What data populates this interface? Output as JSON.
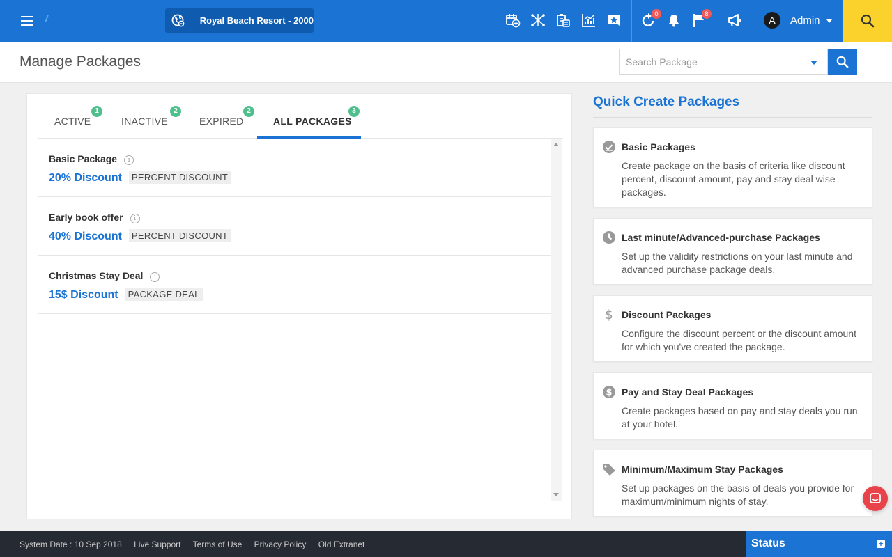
{
  "topbar": {
    "property_label": "Royal Beach Resort -  2000",
    "icons": [
      "calendar-add-icon",
      "network-icon",
      "clipboard-icon",
      "chart-icon",
      "star-icon"
    ],
    "refresh_badge": "0",
    "flag_badge": "8",
    "admin_initial": "A",
    "admin_name": "Admin",
    "colors": {
      "primary": "#1b73d3",
      "search_button": "#fbd22b",
      "badge": "#ef5a5a"
    }
  },
  "header": {
    "title": "Manage Packages",
    "search_placeholder": "Search Package"
  },
  "tabs": [
    {
      "label": "ACTIVE",
      "count": "1"
    },
    {
      "label": "INACTIVE",
      "count": "2"
    },
    {
      "label": "EXPIRED",
      "count": "2"
    },
    {
      "label": "ALL PACKAGES",
      "count": "3",
      "active": true
    }
  ],
  "packages": [
    {
      "name": "Basic Package",
      "discount": "20% Discount",
      "type": "PERCENT DISCOUNT"
    },
    {
      "name": "Early book offer",
      "discount": "40% Discount",
      "type": "PERCENT DISCOUNT"
    },
    {
      "name": "Christmas Stay Deal",
      "discount": "15$ Discount",
      "type": "PACKAGE DEAL"
    }
  ],
  "quick_create": {
    "title": "Quick Create Packages",
    "cards": [
      {
        "icon": "check-circle-icon",
        "title": "Basic Packages",
        "desc": "Create package on the basis of criteria like discount percent, discount amount, pay and stay deal wise packages."
      },
      {
        "icon": "clock-icon",
        "title": "Last minute/Advanced-purchase Packages",
        "desc": "Set up the validity restrictions on your last minute and advanced purchase package deals."
      },
      {
        "icon": "dollar-icon",
        "title": "Discount Packages",
        "desc": "Configure the discount percent or the discount amount for which you've created the package."
      },
      {
        "icon": "dollar-circle-icon",
        "title": "Pay and Stay Deal Packages",
        "desc": "Create packages based on pay and stay deals you run at your hotel."
      },
      {
        "icon": "tag-icon",
        "title": "Minimum/Maximum Stay Packages",
        "desc": "Set up packages on the basis of deals you provide for maximum/minimum nights of stay."
      }
    ]
  },
  "footer": {
    "system_date": "System Date : 10 Sep 2018",
    "links": [
      "Live Support",
      "Terms of Use",
      "Privacy Policy",
      "Old Extranet"
    ],
    "status_label": "Status",
    "status_toggle": "+"
  }
}
